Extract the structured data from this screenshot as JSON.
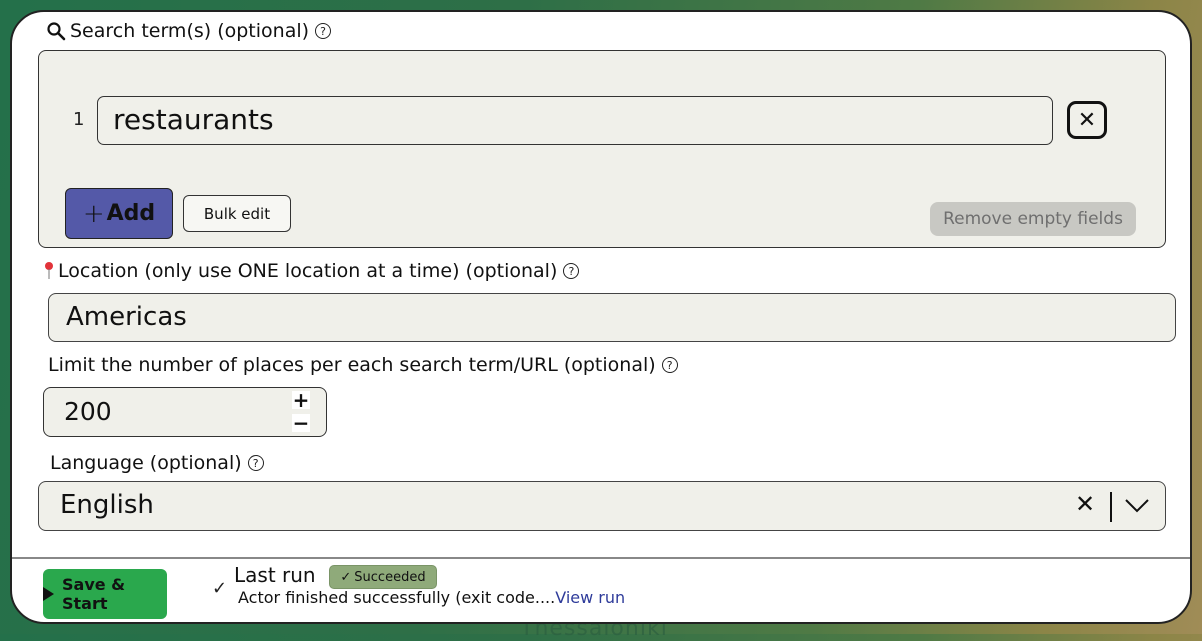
{
  "background": {
    "map_label": "Thessaloniki"
  },
  "search_terms": {
    "label": "Search term(s) (optional)",
    "items": [
      {
        "index": "1",
        "value": "restaurants"
      }
    ],
    "add_label": "Add",
    "bulk_edit_label": "Bulk edit",
    "remove_empty_label": "Remove empty fields"
  },
  "location": {
    "label": "Location (only use ONE location at a time) (optional)",
    "value": "Americas"
  },
  "limit": {
    "label": "Limit the number of places per each search term/URL (optional)",
    "value": "200",
    "increment": "+",
    "decrement": "−"
  },
  "language": {
    "label": "Language (optional)",
    "selected": "English"
  },
  "footer": {
    "start_label": "Save & Start",
    "last_run_label": "Last run",
    "status_badge": "Succeeded",
    "status_color": "#8faa7a",
    "message": "Actor finished successfully (exit code....",
    "view_run_label": "View run"
  },
  "colors": {
    "add_button": "#5459a8",
    "start_button": "#2aa84d",
    "link": "#2e3b9a"
  }
}
